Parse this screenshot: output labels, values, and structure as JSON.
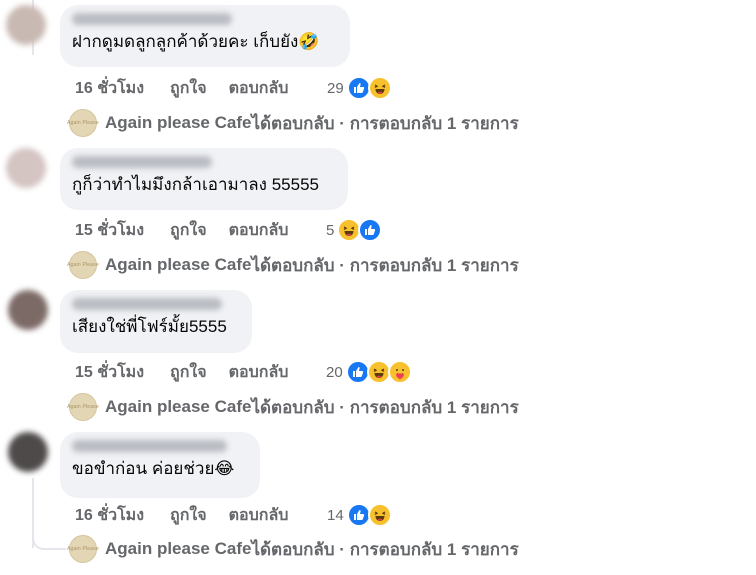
{
  "comments": [
    {
      "text": "ฝากดูมดลูกลูกค้าด้วยคะ เก็บยัง🤣",
      "time": "16 ชั่วโมง",
      "like_label": "ถูกใจ",
      "reply_label": "ตอบกลับ",
      "reaction_count": "29",
      "reactions": [
        "like-icon",
        "haha-icon"
      ],
      "replies": {
        "page_name": "Again please Cafe",
        "text": " ได้ตอบกลับ · การตอบกลับ 1 รายการ",
        "avatar_text": "Again Please"
      }
    },
    {
      "text": "กูก็ว่าทำไมมึงกล้าเอามาลง 55555",
      "time": "15 ชั่วโมง",
      "like_label": "ถูกใจ",
      "reply_label": "ตอบกลับ",
      "reaction_count": "5",
      "reactions": [
        "haha-icon",
        "like-icon"
      ],
      "replies": {
        "page_name": "Again please Cafe",
        "text": " ได้ตอบกลับ · การตอบกลับ 1 รายการ",
        "avatar_text": "Again Please"
      }
    },
    {
      "text": "เสียงใช่พี่โฟร์มั้ย5555",
      "time": "15 ชั่วโมง",
      "like_label": "ถูกใจ",
      "reply_label": "ตอบกลับ",
      "reaction_count": "20",
      "reactions": [
        "like-icon",
        "haha-icon",
        "care-icon"
      ],
      "replies": {
        "page_name": "Again please Cafe",
        "text": " ได้ตอบกลับ · การตอบกลับ 1 รายการ",
        "avatar_text": "Again Please"
      }
    },
    {
      "text": "ขอขำก่อน ค่อยช่วย😂",
      "time": "16 ชั่วโมง",
      "like_label": "ถูกใจ",
      "reply_label": "ตอบกลับ",
      "reaction_count": "14",
      "reactions": [
        "like-icon",
        "haha-icon"
      ],
      "replies": {
        "page_name": "Again please Cafe",
        "text": " ได้ตอบกลับ · การตอบกลับ 1 รายการ",
        "avatar_text": "Again Please"
      }
    }
  ],
  "colors": {
    "bubble": "#f0f2f5",
    "meta_text": "#65676b",
    "like_blue": "#1877f2",
    "haha_yellow": "#f7c12d"
  }
}
